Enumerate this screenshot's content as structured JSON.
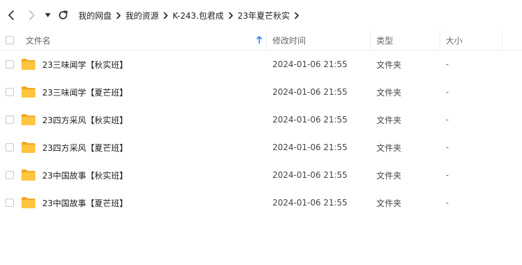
{
  "breadcrumb": [
    "我的网盘",
    "我的资源",
    "K-243.包君成",
    "23年夏芒秋实"
  ],
  "columns": {
    "name": "文件名",
    "modified": "修改时间",
    "type": "类型",
    "size": "大小"
  },
  "sort": {
    "column": "name",
    "direction": "ascending"
  },
  "colors": {
    "folder": "#FFC53D",
    "folder_dark": "#F5A623",
    "sort_arrow": "#2F7BF5"
  },
  "files": [
    {
      "name": "23三味闻学【秋实班】",
      "modified": "2024-01-06 21:55",
      "type": "文件夹",
      "size": "-"
    },
    {
      "name": "23三味闻学【夏芒班】",
      "modified": "2024-01-06 21:55",
      "type": "文件夹",
      "size": "-"
    },
    {
      "name": "23四方采风【秋实班】",
      "modified": "2024-01-06 21:55",
      "type": "文件夹",
      "size": "-"
    },
    {
      "name": "23四方采风【夏芒班】",
      "modified": "2024-01-06 21:55",
      "type": "文件夹",
      "size": "-"
    },
    {
      "name": "23中国故事【秋实班】",
      "modified": "2024-01-06 21:55",
      "type": "文件夹",
      "size": "-"
    },
    {
      "name": "23中国故事【夏芒班】",
      "modified": "2024-01-06 21:55",
      "type": "文件夹",
      "size": "-"
    }
  ]
}
